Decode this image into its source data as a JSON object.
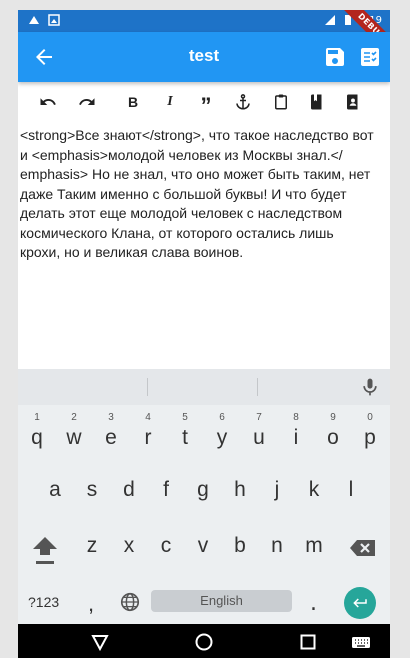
{
  "status_bar": {
    "time": "4:19",
    "debug_label": "DEBUG"
  },
  "app_bar": {
    "title": "test",
    "back_icon": "arrow-back-icon",
    "save_icon": "save-icon",
    "checklist_icon": "checklist-icon"
  },
  "toolbar": {
    "items": [
      "undo-icon",
      "redo-icon",
      "bold-icon",
      "italic-icon",
      "quote-icon",
      "anchor-icon",
      "clipboard-icon",
      "book-icon",
      "account-box-icon"
    ],
    "bold_label": "B",
    "italic_label": "I",
    "quote_label": "”"
  },
  "editor": {
    "lines": [
      "<strong>Все знают</strong>, что такое наследство вот",
      "и <emphasis>молодой человек из Москвы знал.</",
      "emphasis> Но не знал, что оно может быть таким, нет",
      "даже Таким именно с большой буквы! И что будет",
      "делать этот еще молодой человек с наследством",
      "космического Клана, от которого остались лишь",
      "крохи, но и великая слава воинов."
    ]
  },
  "keyboard": {
    "row1": [
      {
        "main": "q",
        "sub": "1"
      },
      {
        "main": "w",
        "sub": "2"
      },
      {
        "main": "e",
        "sub": "3"
      },
      {
        "main": "r",
        "sub": "4"
      },
      {
        "main": "t",
        "sub": "5"
      },
      {
        "main": "y",
        "sub": "6"
      },
      {
        "main": "u",
        "sub": "7"
      },
      {
        "main": "i",
        "sub": "8"
      },
      {
        "main": "o",
        "sub": "9"
      },
      {
        "main": "p",
        "sub": "0"
      }
    ],
    "row2": [
      "a",
      "s",
      "d",
      "f",
      "g",
      "h",
      "j",
      "k",
      "l"
    ],
    "row3": [
      "z",
      "x",
      "c",
      "v",
      "b",
      "n",
      "m"
    ],
    "key_123": "?123",
    "comma": ",",
    "period": ".",
    "space_label": "English"
  },
  "colors": {
    "app_bar": "#2196f3",
    "status_bar": "#1e73c8",
    "enter_key": "#26a69a",
    "debug_ribbon": "#b3261e"
  }
}
